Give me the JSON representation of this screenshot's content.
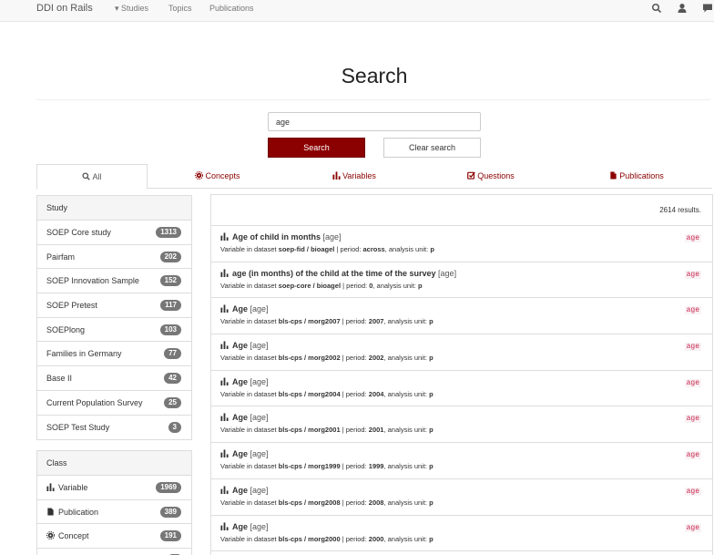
{
  "navbar": {
    "brand": "DDI on Rails",
    "studies": "▾ Studies",
    "topics": "Topics",
    "publications": "Publications",
    "icons": [
      "search-icon",
      "user-icon",
      "comment-icon"
    ]
  },
  "page": {
    "title": "Search"
  },
  "search": {
    "value": "age",
    "search_label": "Search",
    "clear_label": "Clear search"
  },
  "tabs": [
    {
      "label": "All",
      "icon": "search-icon",
      "active": true
    },
    {
      "label": "Concepts",
      "icon": "cog-icon",
      "active": false
    },
    {
      "label": "Variables",
      "icon": "bar-chart-icon",
      "active": false
    },
    {
      "label": "Questions",
      "icon": "check-square-icon",
      "active": false
    },
    {
      "label": "Publications",
      "icon": "file-icon",
      "active": false
    }
  ],
  "facets": {
    "study": {
      "heading": "Study",
      "items": [
        {
          "label": "SOEP Core study",
          "count": "1313"
        },
        {
          "label": "Pairfam",
          "count": "202"
        },
        {
          "label": "SOEP Innovation Sample",
          "count": "152"
        },
        {
          "label": "SOEP Pretest",
          "count": "117"
        },
        {
          "label": "SOEPlong",
          "count": "103"
        },
        {
          "label": "Families in Germany",
          "count": "77"
        },
        {
          "label": "Base II",
          "count": "42"
        },
        {
          "label": "Current Population Survey",
          "count": "25"
        },
        {
          "label": "SOEP Test Study",
          "count": "3"
        }
      ]
    },
    "class": {
      "heading": "Class",
      "items": [
        {
          "label": "Variable",
          "count": "1969",
          "icon": "bar-chart-icon"
        },
        {
          "label": "Publication",
          "count": "389",
          "icon": "file-icon"
        },
        {
          "label": "Concept",
          "count": "191",
          "icon": "cog-icon"
        }
      ]
    }
  },
  "results": {
    "count": "2614 results.",
    "items": [
      {
        "title": "Age of child in months",
        "var": "[age]",
        "prefix": "Variable in dataset",
        "dataset": "soep-fid / bioagel",
        "period": "across",
        "unit": "p",
        "tag": "age"
      },
      {
        "title": "age (in months) of the child at the time of the survey",
        "var": "[age]",
        "prefix": "Variable in dataset",
        "dataset": "soep-core / bioagel",
        "period": "0",
        "unit": "p",
        "tag": "age"
      },
      {
        "title": "Age",
        "var": "[age]",
        "prefix": "Variable in dataset",
        "dataset": "bls-cps / morg2007",
        "period": "2007",
        "unit": "p",
        "tag": "age"
      },
      {
        "title": "Age",
        "var": "[age]",
        "prefix": "Variable in dataset",
        "dataset": "bls-cps / morg2002",
        "period": "2002",
        "unit": "p",
        "tag": "age"
      },
      {
        "title": "Age",
        "var": "[age]",
        "prefix": "Variable in dataset",
        "dataset": "bls-cps / morg2004",
        "period": "2004",
        "unit": "p",
        "tag": "age"
      },
      {
        "title": "Age",
        "var": "[age]",
        "prefix": "Variable in dataset",
        "dataset": "bls-cps / morg2001",
        "period": "2001",
        "unit": "p",
        "tag": "age"
      },
      {
        "title": "Age",
        "var": "[age]",
        "prefix": "Variable in dataset",
        "dataset": "bls-cps / morg1999",
        "period": "1999",
        "unit": "p",
        "tag": "age"
      },
      {
        "title": "Age",
        "var": "[age]",
        "prefix": "Variable in dataset",
        "dataset": "bls-cps / morg2008",
        "period": "2008",
        "unit": "p",
        "tag": "age"
      },
      {
        "title": "Age",
        "var": "[age]",
        "prefix": "Variable in dataset",
        "dataset": "bls-cps / morg2000",
        "period": "2000",
        "unit": "p",
        "tag": "age"
      }
    ],
    "labels": {
      "period": "| period:",
      "unit": ", analysis unit:"
    }
  },
  "colors": {
    "accent": "#8b0000",
    "badge": "#777777",
    "tag": "#c7254e"
  }
}
